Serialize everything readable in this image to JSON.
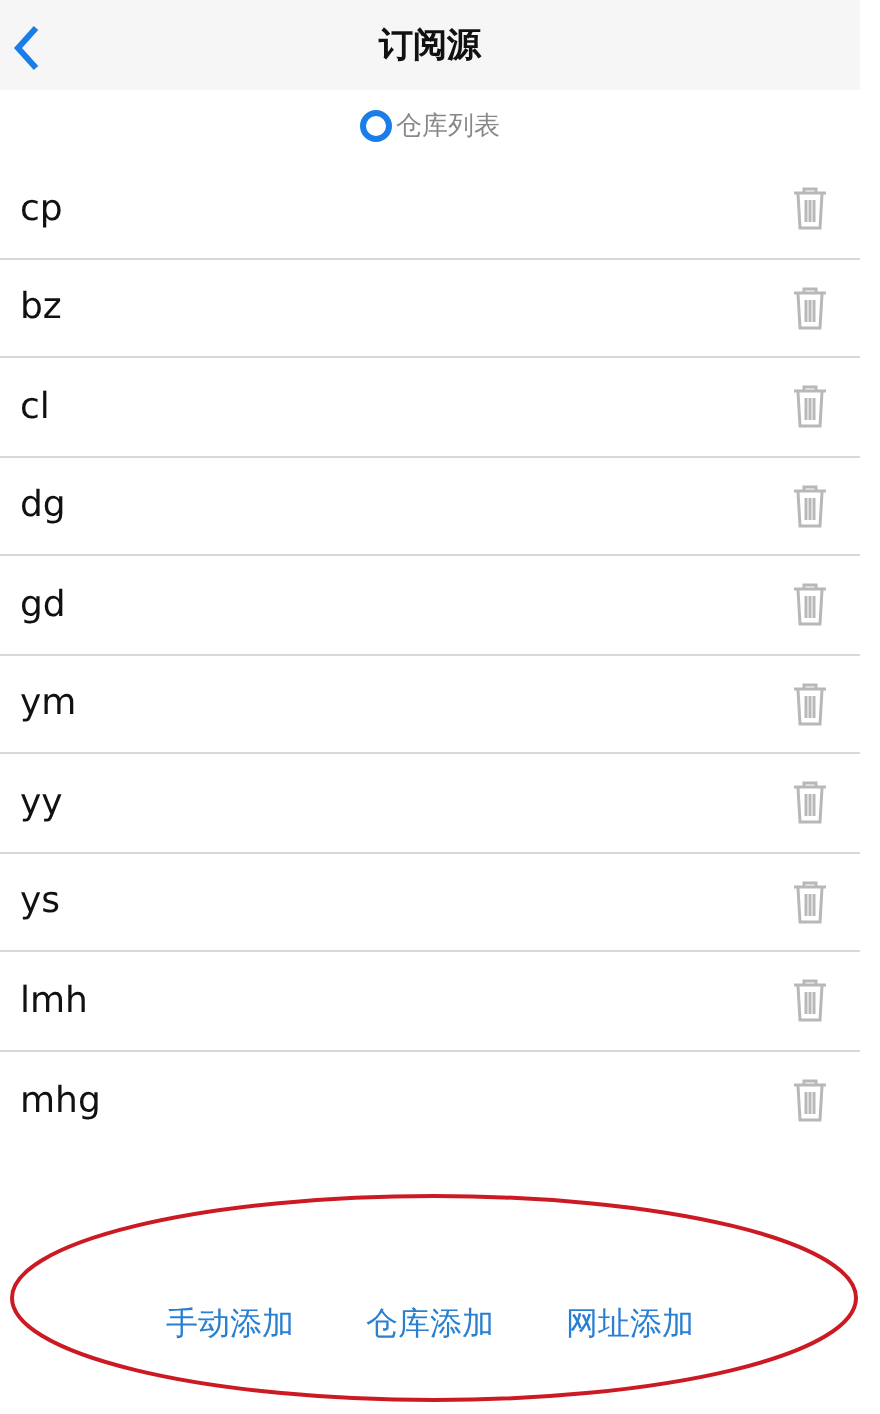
{
  "header": {
    "title": "订阅源"
  },
  "source_options": [
    {
      "label": "仓库列表",
      "selected": true
    }
  ],
  "subscriptions": [
    {
      "name": "cp"
    },
    {
      "name": "bz"
    },
    {
      "name": "cl"
    },
    {
      "name": "dg"
    },
    {
      "name": "gd"
    },
    {
      "name": "ym"
    },
    {
      "name": "yy"
    },
    {
      "name": "ys"
    },
    {
      "name": "lmh"
    },
    {
      "name": "mhg"
    }
  ],
  "actions": [
    "手动添加",
    "仓库添加",
    "网址添加"
  ]
}
